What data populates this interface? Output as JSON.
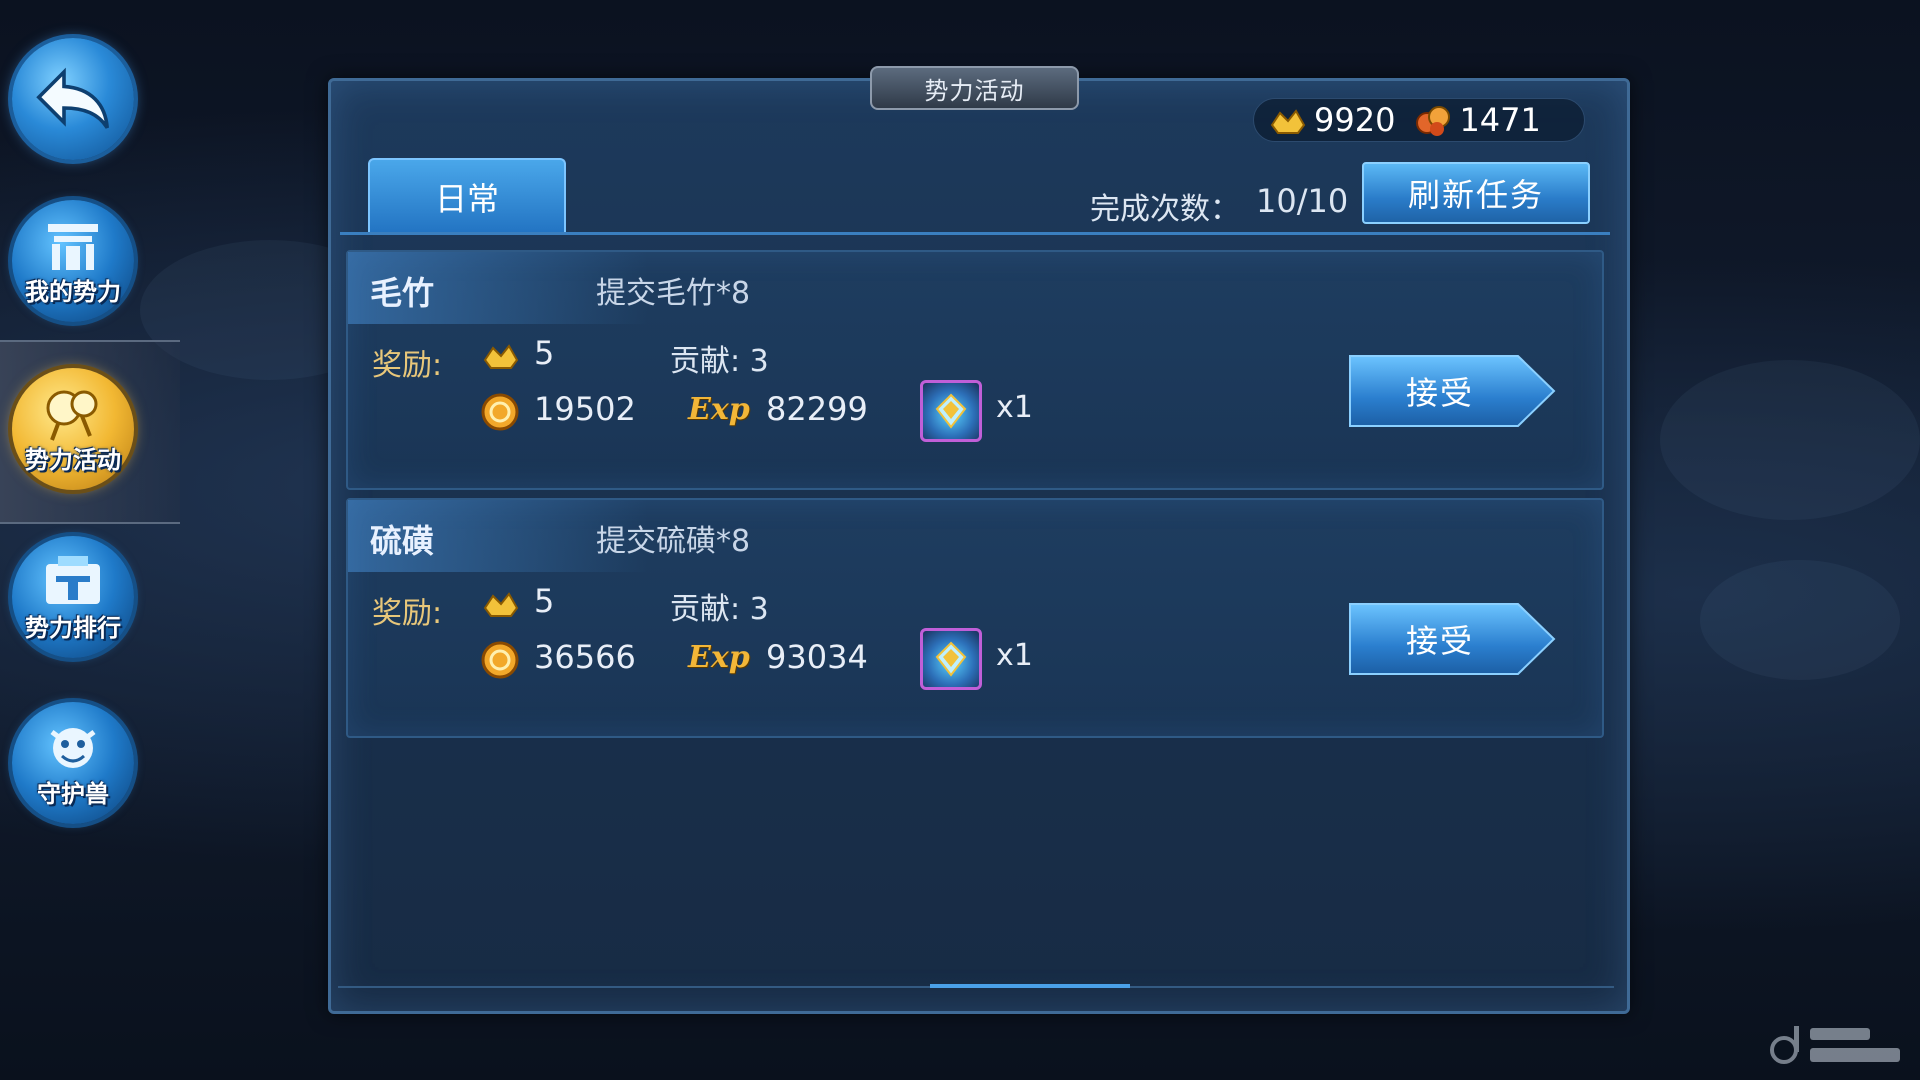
{
  "nav": {
    "back_label": "",
    "items": [
      {
        "label": "我的势力",
        "active": false
      },
      {
        "label": "势力活动",
        "active": true
      },
      {
        "label": "势力排行",
        "active": false
      },
      {
        "label": "守护兽",
        "active": false
      }
    ]
  },
  "panel": {
    "title": "势力活动",
    "currency": {
      "gold": "9920",
      "contribution": "1471"
    },
    "tab": "日常",
    "complete_label": "完成次数：",
    "complete_value": "10/10",
    "refresh_label": "刷新任务"
  },
  "tasks": [
    {
      "name": "毛竹",
      "desc": "提交毛竹*8",
      "reward_label": "奖励:",
      "gold": "5",
      "contrib": "贡献: 3",
      "coins": "19502",
      "exp_label": "Exp",
      "exp": "82299",
      "item_count": "x1",
      "accept_label": "接受"
    },
    {
      "name": "硫磺",
      "desc": "提交硫磺*8",
      "reward_label": "奖励:",
      "gold": "5",
      "contrib": "贡献: 3",
      "coins": "36566",
      "exp_label": "Exp",
      "exp": "93034",
      "item_count": "x1",
      "accept_label": "接受"
    }
  ],
  "colors": {
    "panel_bg": "#1a3250",
    "accent_blue": "#2a7cc9",
    "gold_text": "#f2b638",
    "item_border": "#c05fd8"
  },
  "icons": [
    "back-arrow-icon",
    "gold-ingot-icon",
    "contribution-icon",
    "coin-icon",
    "soul-item-icon"
  ]
}
